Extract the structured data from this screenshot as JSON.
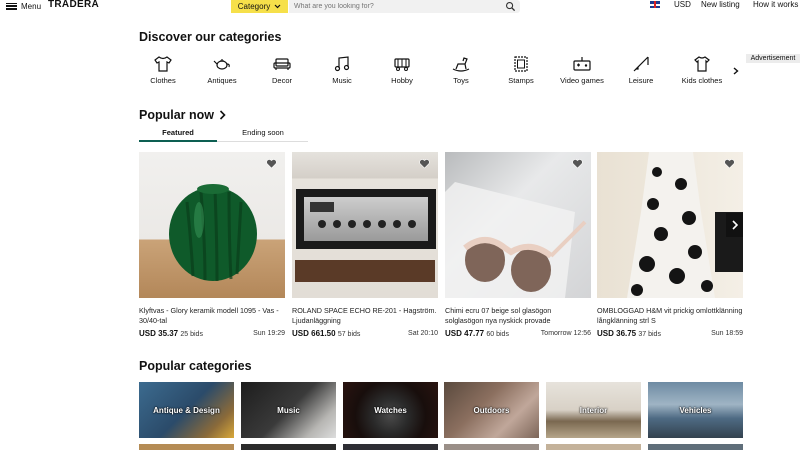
{
  "header": {
    "menu_label": "Menu",
    "logo": "TRADERA",
    "category_label": "Category",
    "search_placeholder": "What are you looking for?",
    "currency": "USD",
    "new_listing": "New listing",
    "how_it_works": "How it works"
  },
  "discover": {
    "title": "Discover our categories",
    "categories": [
      {
        "label": "Clothes",
        "icon": "tshirt-icon"
      },
      {
        "label": "Antiques",
        "icon": "teapot-icon"
      },
      {
        "label": "Decor",
        "icon": "sofa-icon"
      },
      {
        "label": "Music",
        "icon": "music-note-icon"
      },
      {
        "label": "Hobby",
        "icon": "train-icon"
      },
      {
        "label": "Toys",
        "icon": "rocking-horse-icon"
      },
      {
        "label": "Stamps",
        "icon": "stamp-icon"
      },
      {
        "label": "Video games",
        "icon": "game-console-icon"
      },
      {
        "label": "Leisure",
        "icon": "fishing-rod-icon"
      },
      {
        "label": "Kids clothes",
        "icon": "kids-shirt-icon"
      }
    ]
  },
  "advertisement_label": "Advertisement",
  "popular_now": {
    "title": "Popular now",
    "tabs": [
      "Featured",
      "Ending soon"
    ],
    "items": [
      {
        "title": "Klyftvas - Glory keramik modell 1095 - Vas - 30/40-tal",
        "price": "USD 35.37",
        "bids": "25 bids",
        "time": "Sun 19:29"
      },
      {
        "title": "ROLAND SPACE ECHO RE-201 - Hagström. Ljudanläggning",
        "price": "USD 661.50",
        "bids": "57 bids",
        "time": "Sat 20:10"
      },
      {
        "title": "Chimi ecru 07 beige sol glasögon solglasögon nya nyskick provade",
        "price": "USD 47.77",
        "bids": "60 bids",
        "time": "Tomorrow 12:56"
      },
      {
        "title": "OMBLOGGAD H&M vit prickig omlottklänning långklänning strl S",
        "price": "USD 36.75",
        "bids": "37 bids",
        "time": "Sun 18:59"
      }
    ]
  },
  "popular_categories": {
    "title": "Popular categories",
    "items": [
      "Antique & Design",
      "Music",
      "Watches",
      "Outdoors",
      "Interior",
      "Vehicles"
    ]
  },
  "colors": {
    "accent_yellow": "#f6e04a",
    "tab_underline": "#0d5f52"
  }
}
